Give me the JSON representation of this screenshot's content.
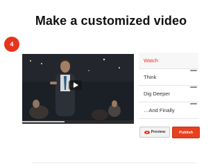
{
  "slide": {
    "title": "Make a customized video"
  },
  "step": {
    "number": "4"
  },
  "video": {
    "progress_fraction": 0.38
  },
  "panel": {
    "items": [
      {
        "label": "Watch"
      },
      {
        "label": "Think"
      },
      {
        "label": "Dig Deeper"
      },
      {
        "label": "…And Finally"
      }
    ],
    "active_index": 0
  },
  "actions": {
    "preview_label": "Preview",
    "publish_label": "Publish"
  },
  "colors": {
    "accent": "#e8341c",
    "publish": "#e8401f"
  },
  "icons": {
    "play": "play-icon",
    "preview": "eye-icon"
  }
}
